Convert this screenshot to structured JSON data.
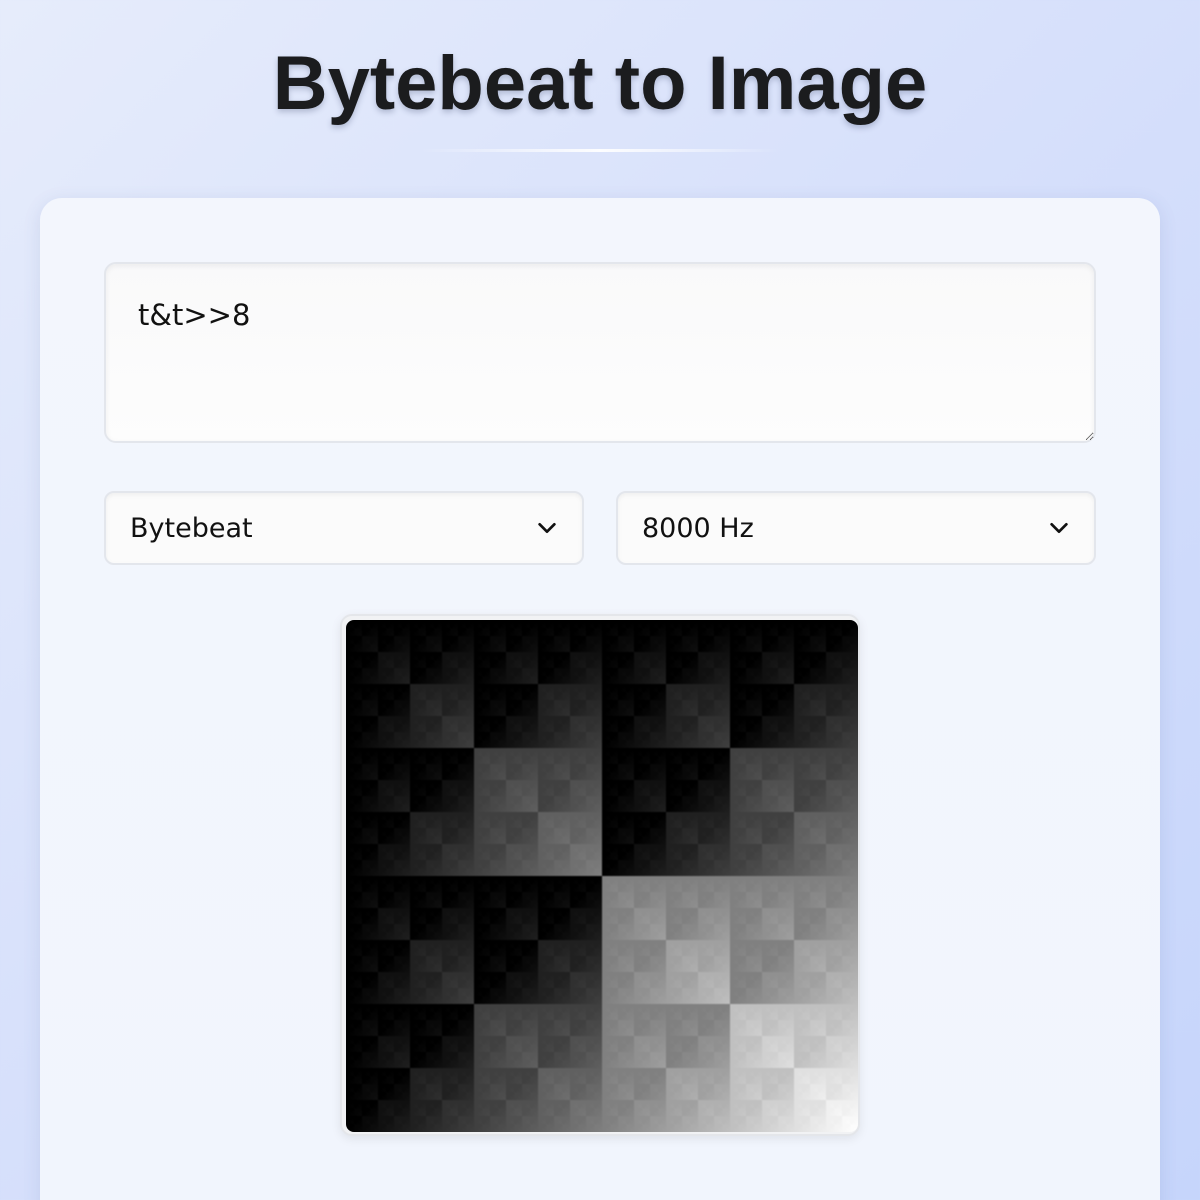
{
  "page": {
    "title": "Bytebeat to Image"
  },
  "editor": {
    "expression": "t&t>>8"
  },
  "controls": {
    "mode": {
      "selected": "Bytebeat"
    },
    "sample_rate": {
      "selected": "8000 Hz"
    }
  },
  "output": {
    "image_size": 256
  },
  "icons": {
    "dropdown": "chevron-down-icon"
  }
}
